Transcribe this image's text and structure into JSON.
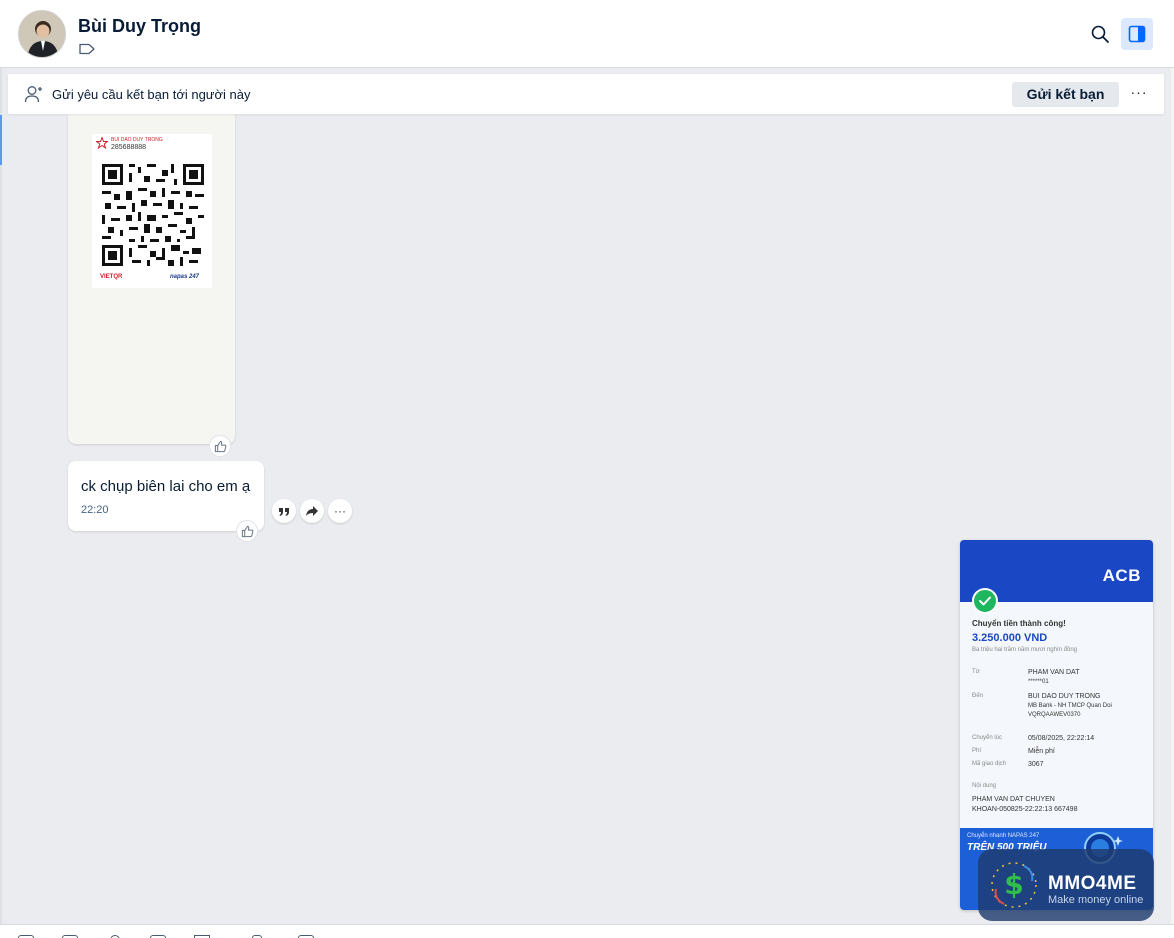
{
  "header": {
    "contact_name": "Bùi Duy Trọng"
  },
  "friend_request": {
    "text": "Gửi yêu cầu kết bạn tới người này",
    "button_label": "Gửi kết bạn",
    "more_label": "···"
  },
  "image_message": {
    "qr_card": {
      "account_name": "BUI DAO DUY TRONG",
      "account_number": "285688888",
      "brand_left": "VIETQR",
      "brand_right": "napas 247"
    }
  },
  "text_message": {
    "body": "ck chụp biên lai cho em ạ",
    "time": "22:20"
  },
  "actions": {
    "more_label": "···"
  },
  "receipt": {
    "bank_logo": "ACB",
    "status": "Chuyển tiền thành công!",
    "amount": "3.250.000 VND",
    "amount_words": "Ba triệu hai trăm năm mươi nghìn đồng",
    "from_label": "Từ",
    "from_name": "PHAM VAN DAT",
    "from_account": "******01",
    "to_label": "Đến",
    "to_name": "BUI DAO DUY TRONG",
    "to_bank": "MB Bank - NH TMCP Quan Doi",
    "to_account": "VQRQAAWEV0370",
    "time_label": "Chuyển lúc",
    "time_value": "05/08/2025, 22:22:14",
    "fee_label": "Phí",
    "fee_value": "Miễn phí",
    "txn_label": "Mã giao dịch",
    "txn_value": "3067",
    "content_label": "Nội dung",
    "content_line1": "PHAM VAN DAT CHUYEN",
    "content_line2": "KHOAN-050825-22:22:13 667498",
    "promo_line1": "Chuyển nhanh NAPAS 247",
    "promo_line2": "TRÊN 500 TRIỆU"
  },
  "watermark": {
    "title": "MMO4ME",
    "subtitle": "Make money online"
  },
  "colors": {
    "accent": "#0068ff",
    "chat_bg": "#ebecf0",
    "acb_blue": "#1a47c4"
  }
}
